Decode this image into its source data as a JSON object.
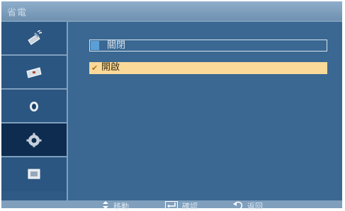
{
  "window": {
    "title": "省電"
  },
  "sidebar": {
    "items": [
      {
        "icon": "picture-icon",
        "selected": false
      },
      {
        "icon": "input-source-icon",
        "selected": false
      },
      {
        "icon": "sound-icon",
        "selected": false
      },
      {
        "icon": "settings-gear-icon",
        "selected": true
      },
      {
        "icon": "multi-screen-icon",
        "selected": false
      }
    ]
  },
  "options": [
    {
      "label": "關閉",
      "selected": false
    },
    {
      "label": "開啟",
      "selected": true,
      "check": "✔"
    }
  ],
  "footer": {
    "move": {
      "icon": "up-down-arrows-icon",
      "label": "移動"
    },
    "enter": {
      "icon": "enter-icon",
      "label": "確認"
    },
    "return": {
      "icon": "return-icon",
      "label": "返回"
    }
  },
  "colors": {
    "frame": "#7f9fbd",
    "sidebar": "#2b5681",
    "sidebar_selected": "#0e2c50",
    "main_panel": "#3a6893",
    "highlight": "#fbd999"
  }
}
